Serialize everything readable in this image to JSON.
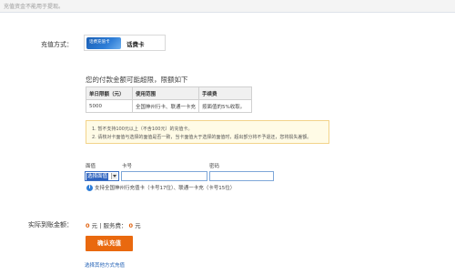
{
  "header": {
    "note": "充值资金不能用于提现。"
  },
  "recharge_method": {
    "label": "充值方式：",
    "card_image_text": "话费充值卡",
    "selected_tab": "话费卡"
  },
  "limits": {
    "title": "您的付款金额可能超限，限额如下",
    "headers": [
      "单日限额（元）",
      "使用范围",
      "手续费"
    ],
    "rows": [
      [
        "5000",
        "全国神州行卡、联通一卡充",
        "按面值的5%收取。"
      ]
    ]
  },
  "notices": [
    "1.  暂不支持100元以上（不含100元）的充值卡。",
    "2.  请核对卡面值与选择的面值是否一致，当卡面值大于选择的面值时，超出部分将不予退还，您将损失差额。"
  ],
  "form": {
    "denomination_label": "面值",
    "card_number_label": "卡号",
    "password_label": "密码",
    "denomination_selected": "选择面值",
    "card_number_value": "",
    "password_value": "",
    "support_text": "支持全国神州行充值卡（卡号17位）、联通一卡充（卡号15位）"
  },
  "summary": {
    "label": "实际到账金额：",
    "amount": "0",
    "unit1": "元",
    "fee_label": "服务费：",
    "fee": "0",
    "unit2": "元"
  },
  "confirm_button": "确认充值",
  "other_method_link": "选择其他方式充值",
  "colors": {
    "accent": "#e9690f",
    "link": "#1f5fb5",
    "notice_bg": "#fffbe6"
  }
}
